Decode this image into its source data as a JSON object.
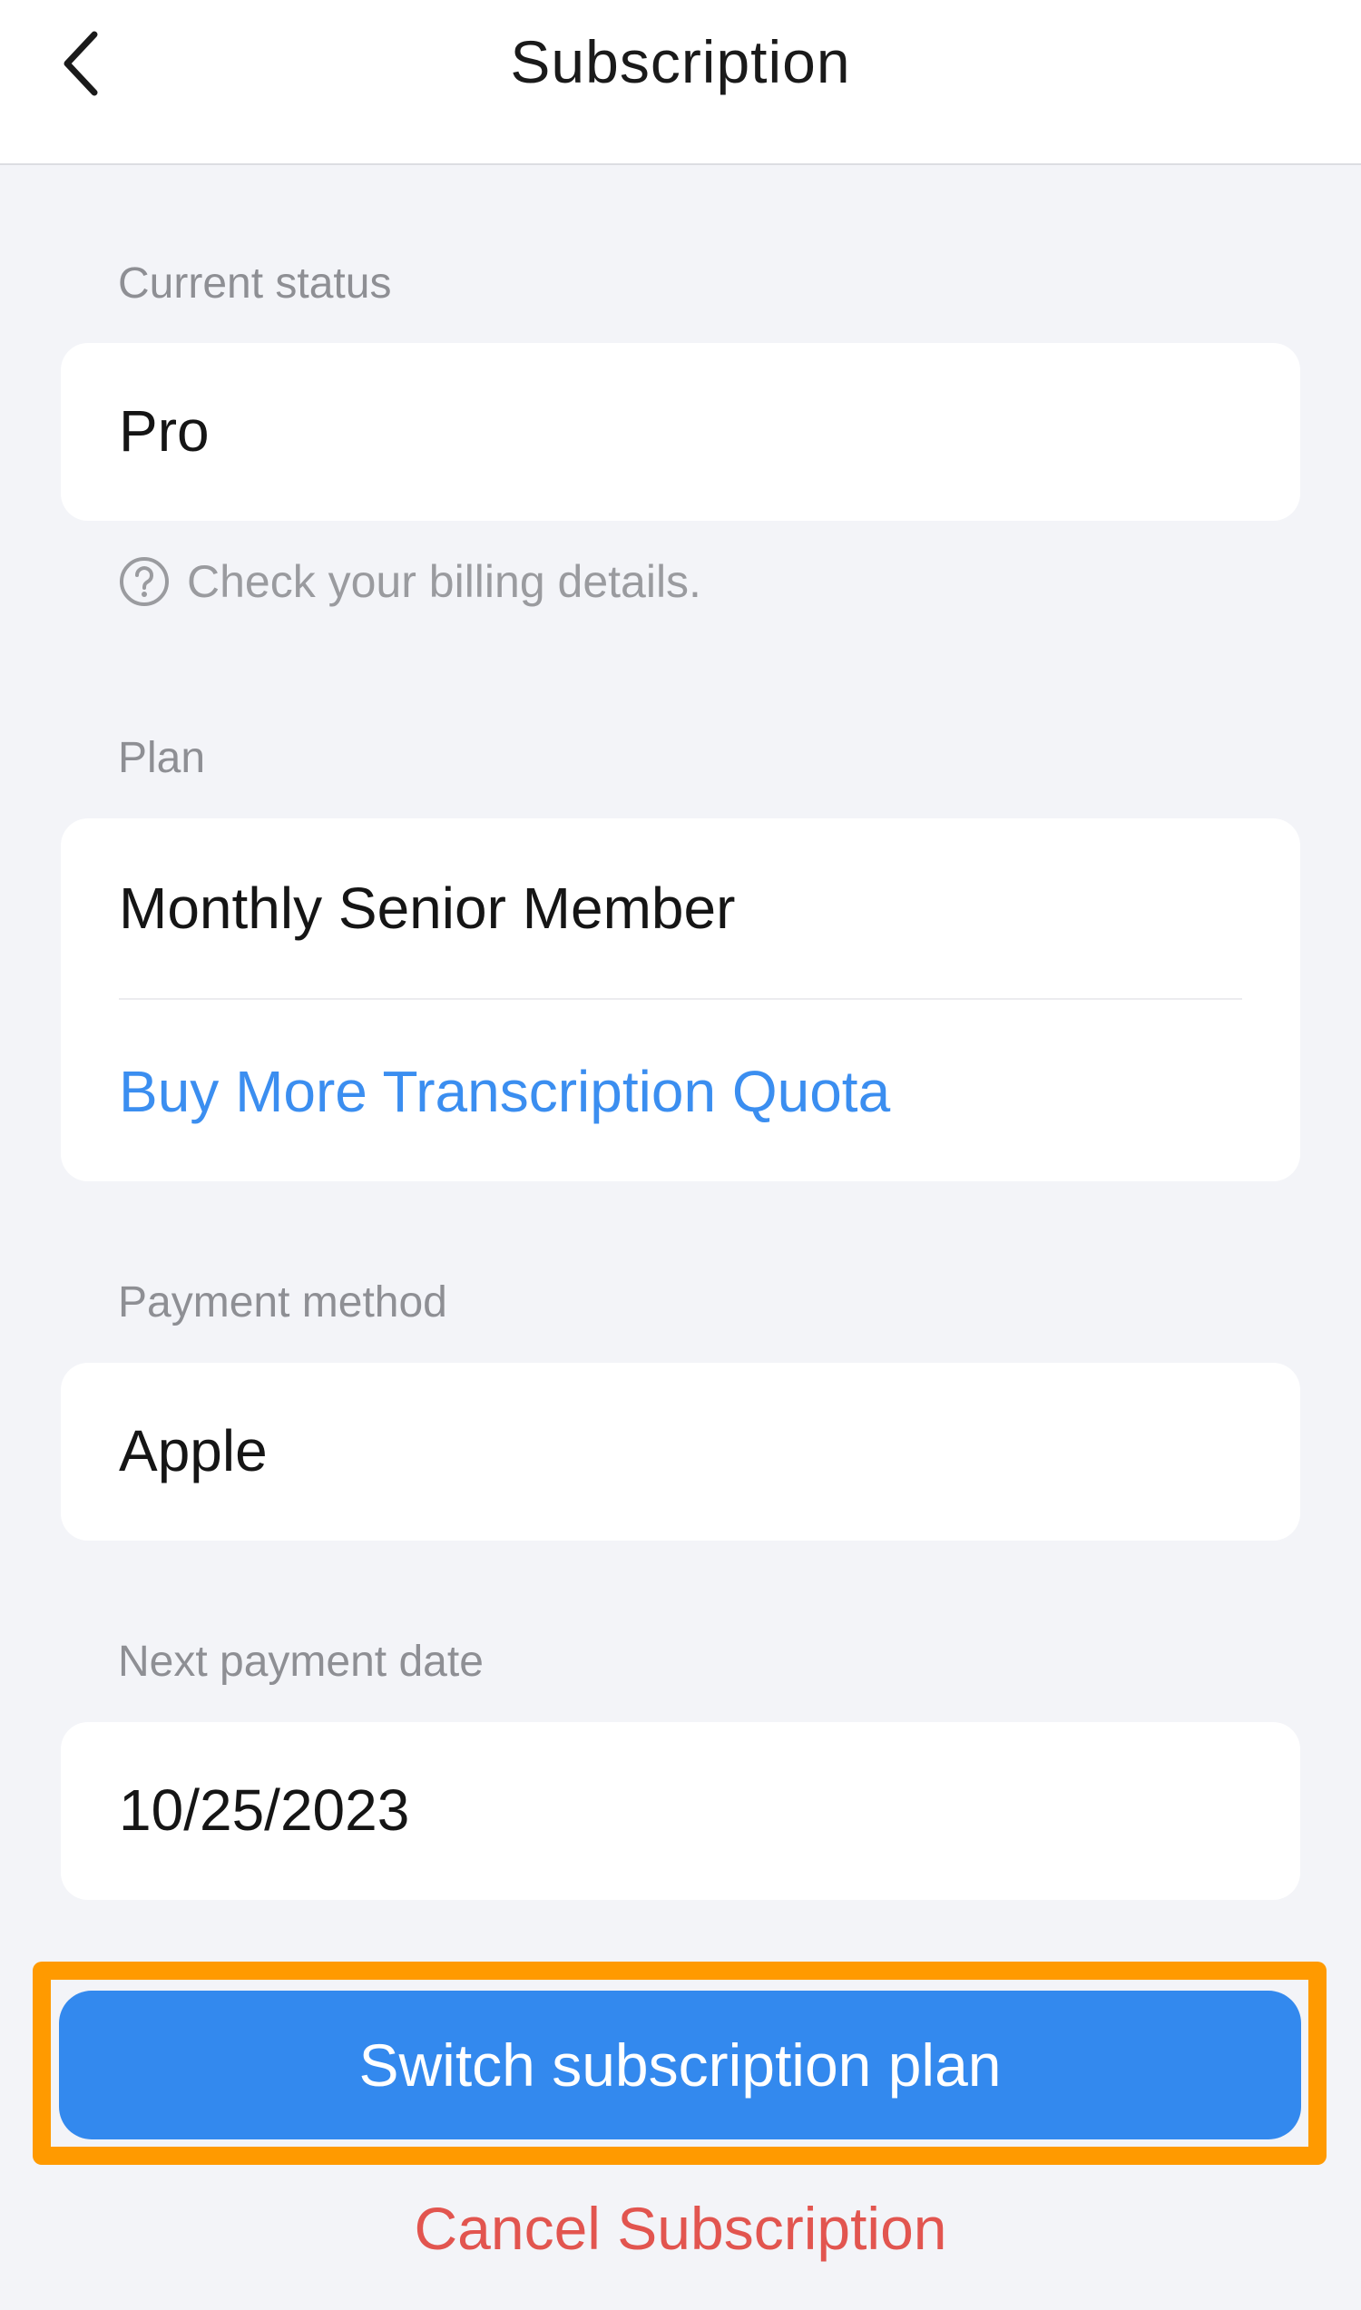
{
  "header": {
    "title": "Subscription",
    "back_icon": "chevron-left-icon"
  },
  "status": {
    "label": "Current status",
    "value": "Pro",
    "hint_icon": "question-circle-icon",
    "hint": "Check your billing details."
  },
  "plan": {
    "label": "Plan",
    "value": "Monthly Senior Member",
    "link": "Buy More Transcription Quota"
  },
  "payment": {
    "label": "Payment method",
    "value": "Apple"
  },
  "next_payment": {
    "label": "Next payment date",
    "value": "10/25/2023"
  },
  "actions": {
    "switch_label": "Switch subscription plan",
    "cancel_label": "Cancel Subscription"
  },
  "colors": {
    "accent_blue": "#3389ee",
    "link_blue": "#3b8ef0",
    "danger_red": "#e2554f",
    "highlight_orange": "#ff9a00",
    "background": "#f3f4f8"
  }
}
